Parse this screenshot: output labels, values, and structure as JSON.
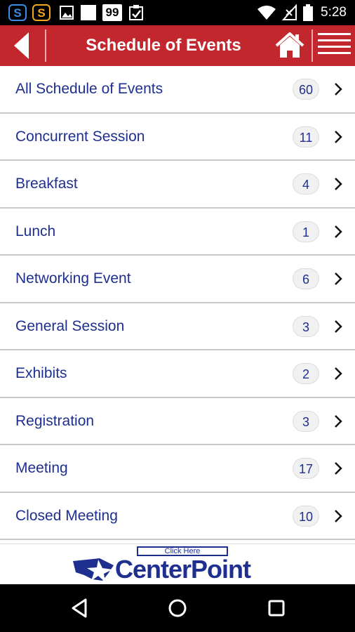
{
  "status_bar": {
    "time": "5:28",
    "notification_badge": "99"
  },
  "header": {
    "title": "Schedule of Events",
    "color": "#c1272d"
  },
  "categories": [
    {
      "label": "All Schedule of Events",
      "count": "60"
    },
    {
      "label": "Concurrent Session",
      "count": "11"
    },
    {
      "label": "Breakfast",
      "count": "4"
    },
    {
      "label": "Lunch",
      "count": "1"
    },
    {
      "label": "Networking Event",
      "count": "6"
    },
    {
      "label": "General Session",
      "count": "3"
    },
    {
      "label": "Exhibits",
      "count": "2"
    },
    {
      "label": "Registration",
      "count": "3"
    },
    {
      "label": "Meeting",
      "count": "17"
    },
    {
      "label": "Closed Meeting",
      "count": "10"
    }
  ],
  "ad": {
    "click_text": "Click Here",
    "brand": "CenterPoint"
  },
  "colors": {
    "accent": "#c1272d",
    "text": "#1e2f8f",
    "divider": "#c9c9c9"
  }
}
